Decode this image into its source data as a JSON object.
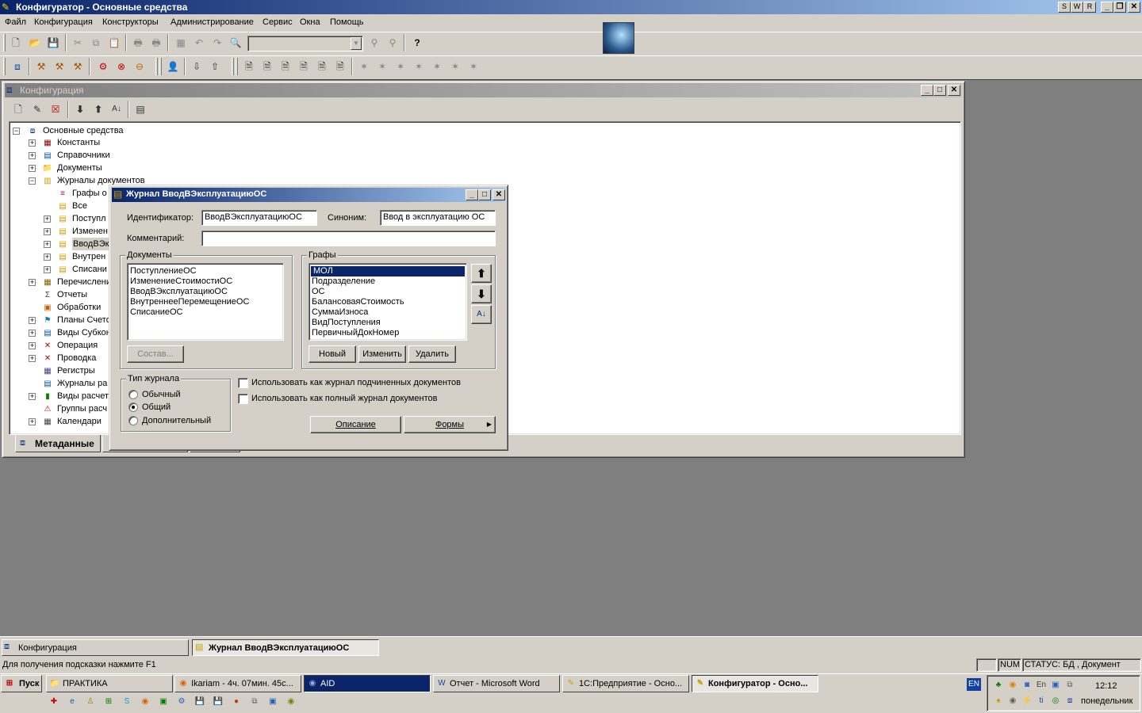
{
  "app": {
    "title": "Конфигуратор - Основные средства",
    "title_controls": [
      "S",
      "W",
      "R"
    ]
  },
  "menu": [
    "Файл",
    "Конфигурация",
    "Конструкторы",
    "Администрирование",
    "Сервис",
    "Окна",
    "Помощь"
  ],
  "config_window": {
    "title": "Конфигурация",
    "tree_root": "Основные средства",
    "tree": [
      "Константы",
      "Справочники",
      "Документы",
      "Журналы документов",
      "Графы о",
      "Все",
      "Поступл",
      "Изменен",
      "ВводВЭк",
      "Внутрен",
      "Списани",
      "Перечислени",
      "Отчеты",
      "Обработки",
      "Планы Счето",
      "Виды Субкон",
      "Операция",
      "Проводка",
      "Регистры",
      "Журналы ра",
      "Виды расчет",
      "Группы расч",
      "Календари"
    ],
    "tab": "Метаданные"
  },
  "dialog": {
    "title": "Журнал ВводВЭксплуатациюОС",
    "identifier_label": "Идентификатор:",
    "identifier_value": "ВводВЭксплуатациюОС",
    "synonym_label": "Синоним:",
    "synonym_value": "Ввод в эксплуатацию ОС",
    "comment_label": "Комментарий:",
    "comment_value": "",
    "documents_label": "Документы",
    "documents": [
      "ПоступлениеОС",
      "ИзменениеСтоимостиОС",
      "ВводВЭксплуатациюОС",
      "ВнутреннееПеремещениеОС",
      "СписаниеОС"
    ],
    "compose_button": "Состав...",
    "columns_label": "Графы",
    "columns": [
      "МОЛ",
      "Подразделение",
      "ОС",
      "БалансоваяСтоимость",
      "СуммаИзноса",
      "ВидПоступления",
      "ПервичныйДокНомер"
    ],
    "new_button": "Новый",
    "edit_button": "Изменить",
    "delete_button": "Удалить",
    "journal_type_label": "Тип журнала",
    "journal_types": [
      "Обычный",
      "Общий",
      "Дополнительный"
    ],
    "selected_type": "Общий",
    "check_sub": "Использовать как журнал подчиненных документов",
    "check_full": "Использовать как полный журнал  документов",
    "description_button": "Описание",
    "forms_button": "Формы"
  },
  "window_tabs": [
    "Конфигурация",
    "Журнал ВводВЭксплуатациюОС"
  ],
  "status": {
    "hint": "Для получения подсказки нажмите F1",
    "num": "NUM",
    "status_text": "СТАТУС: БД , Документ"
  },
  "taskbar": {
    "start": "Пуск",
    "items": [
      "ПРАКТИКА",
      "Ikariam - 4ч. 07мин. 45с...",
      "AID",
      "Отчет - Microsoft Word",
      "1С:Предприятие - Осно...",
      "Конфигуратор - Осно..."
    ],
    "lang": "EN",
    "time": "12:12",
    "day": "понедельник"
  },
  "colors": {
    "title_active": "#0a246a",
    "title_grad": "#a6caf0",
    "selection": "#0a246a",
    "desktop": "#d4d0c8",
    "mdi": "#808080"
  }
}
